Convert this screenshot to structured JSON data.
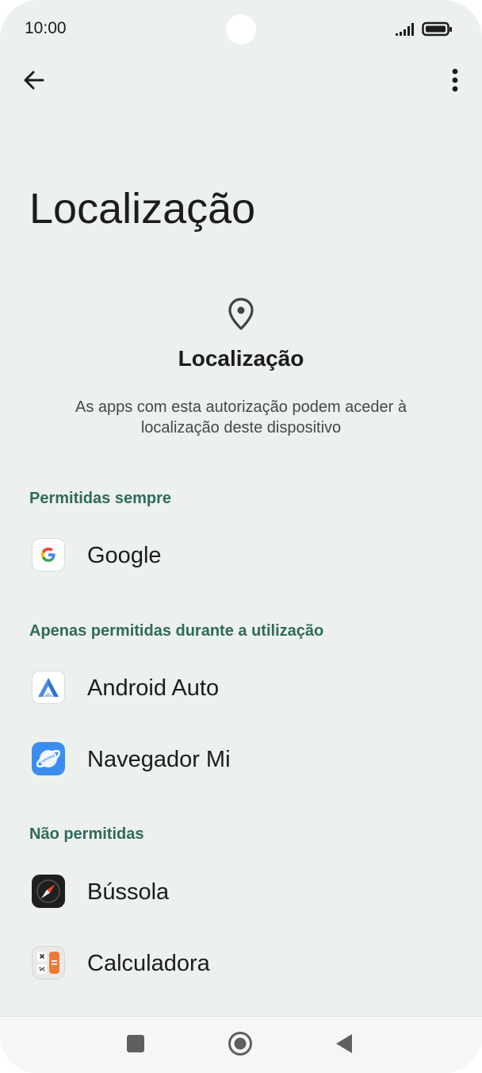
{
  "status_bar": {
    "time": "10:00"
  },
  "toolbar": {
    "back_icon": "arrow-left-icon",
    "menu_icon": "more-vertical-icon"
  },
  "page": {
    "title": "Localização"
  },
  "header": {
    "icon": "location-pin-icon",
    "title": "Localização",
    "description": "As apps com esta autorização podem aceder à localização deste dispositivo"
  },
  "sections": {
    "always": {
      "title": "Permitidas sempre",
      "apps": [
        {
          "label": "Google",
          "icon": "google-icon"
        }
      ]
    },
    "while_in_use": {
      "title": "Apenas permitidas durante a utilização",
      "apps": [
        {
          "label": "Android Auto",
          "icon": "android-auto-icon"
        },
        {
          "label": "Navegador Mi",
          "icon": "mi-browser-icon"
        }
      ]
    },
    "denied": {
      "title": "Não permitidas",
      "apps": [
        {
          "label": "Bússola",
          "icon": "compass-icon"
        },
        {
          "label": "Calculadora",
          "icon": "calculator-icon"
        }
      ]
    }
  },
  "nav_bar": {
    "recents_icon": "recents-square-icon",
    "home_icon": "home-circle-icon",
    "back_icon": "back-triangle-icon"
  },
  "colors": {
    "background": "#edf1ed",
    "section_accent": "#2e6b5b",
    "text_primary": "#1b1c1b"
  }
}
